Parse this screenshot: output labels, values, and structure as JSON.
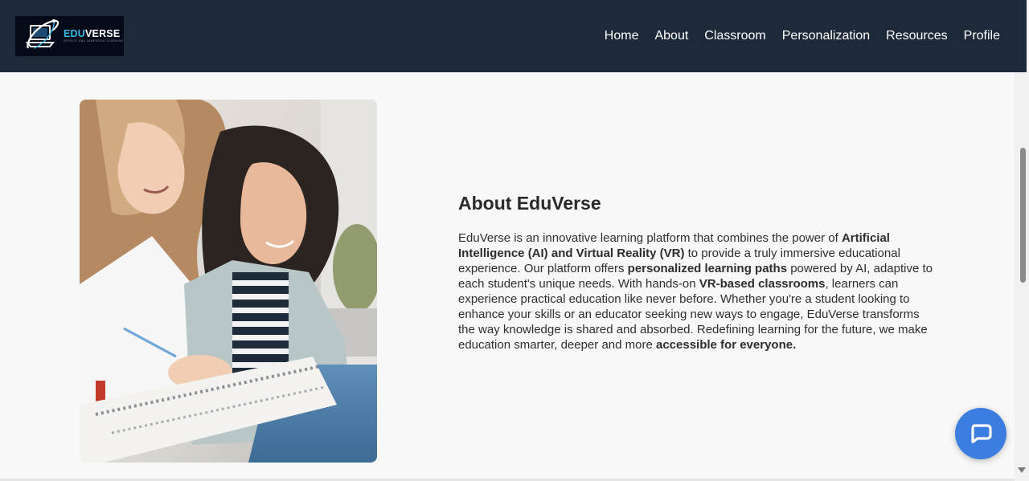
{
  "logo": {
    "word_part1": "EDU",
    "word_part2": "VERSE",
    "tagline": "INFINITE AND IMMERSIVE LEARNING",
    "colors": {
      "background": "#050a18",
      "accent": "#38b8e8"
    }
  },
  "nav": {
    "items": [
      {
        "label": "Home"
      },
      {
        "label": "About"
      },
      {
        "label": "Classroom"
      },
      {
        "label": "Personalization"
      },
      {
        "label": "Resources"
      },
      {
        "label": "Profile"
      }
    ]
  },
  "about": {
    "heading": "About EduVerse",
    "p1": "EduVerse is an innovative learning platform that combines the power of ",
    "b1": "Artificial Intelligence (AI) and Virtual Reality (VR)",
    "p2": " to provide a truly immersive educational experience. Our platform offers ",
    "b2": "personalized learning paths",
    "p3": " powered by AI, adaptive to each student's unique needs. With hands-on ",
    "b3": "VR-based classrooms",
    "p4": ", learners can experience practical education like never before. Whether you're a student looking to enhance your skills or an educator seeking new ways to engage, EduVerse transforms the way knowledge is shared and absorbed. Redefining learning for the future, we make education smarter, deeper and more ",
    "b4": "accessible for everyone."
  },
  "icons": {
    "chat": "chat-bubble-icon",
    "scroll_down": "chevron-down-icon"
  },
  "colors": {
    "navbar": "#1e2a3a",
    "page_background": "#f8f8f8",
    "chat_button": "#3c7de0"
  }
}
